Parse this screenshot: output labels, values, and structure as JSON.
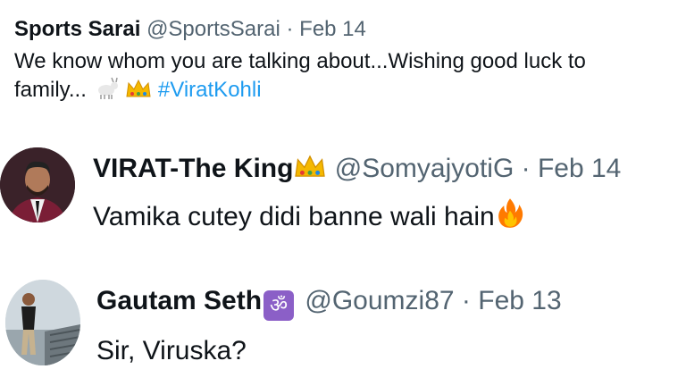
{
  "tweets": [
    {
      "name": "Sports Sarai",
      "handle": "@SportsSarai",
      "date": "· Feb 14",
      "text_line1": "We know whom you are talking about...Wishing good luck to",
      "text_line2": "family...",
      "hashtag": "#ViratKohli",
      "emojis": [
        "goat-emoji",
        "crown-emoji"
      ]
    },
    {
      "name": "VIRAT-The King",
      "handle": "@SomyajyotiG",
      "date": "· Feb 14",
      "text": "Vamika cutey didi banne wali hain",
      "emojis": [
        "crown-emoji",
        "fire-emoji"
      ]
    },
    {
      "name": "Gautam Seth",
      "handle": "@Goumzi87",
      "date": "· Feb 13",
      "text": "Sir, Viruska?",
      "emojis": [
        "om-emoji"
      ]
    }
  ],
  "colors": {
    "text": "#0f1419",
    "muted": "#536471",
    "link": "#1d9bf0",
    "om_bg": "#8b5fc7"
  }
}
